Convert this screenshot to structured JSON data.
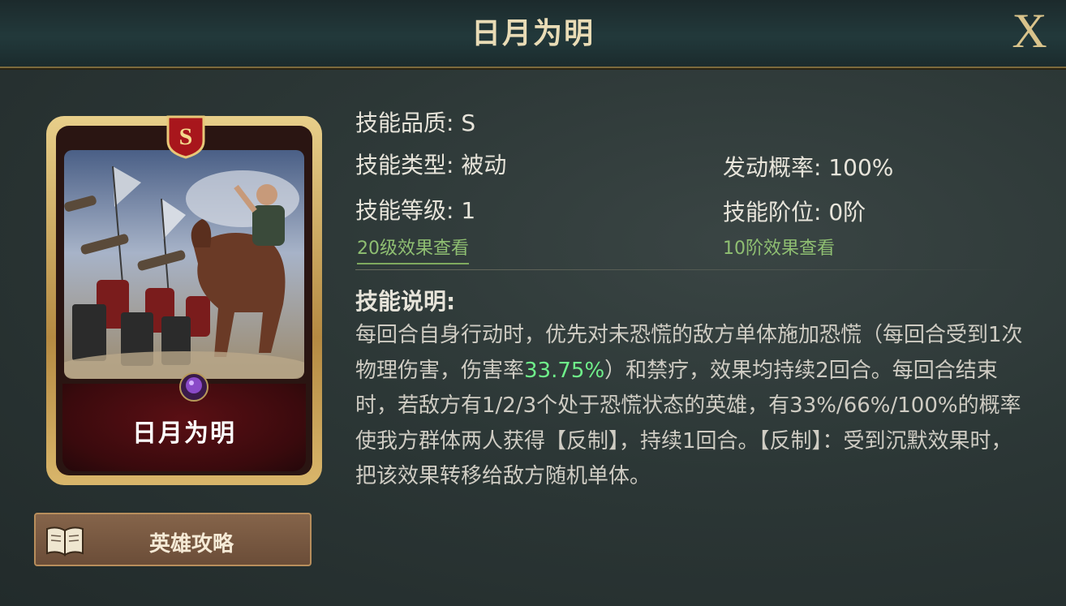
{
  "header": {
    "title": "日月为明",
    "close_label": "X"
  },
  "card": {
    "name": "日月为明",
    "quality_badge": "S"
  },
  "guide_button": {
    "label": "英雄攻略"
  },
  "stats": {
    "quality": "技能品质: S",
    "type": "技能类型: 被动",
    "level": "技能等级: 1",
    "trigger_rate": "发动概率: 100%",
    "rank": "技能阶位: 0阶"
  },
  "links": {
    "level20": "20级效果查看",
    "rank10": "10阶效果查看"
  },
  "description": {
    "title": "技能说明:",
    "part1": "每回合自身行动时，优先对未恐慌的敌方单体施加恐慌（每回合受到1次物理伤害，伤害率",
    "highlight": "33.75%",
    "part2": "）和禁疗，效果均持续2回合。每回合结束时，若敌方有1/2/3个处于恐慌状态的英雄，有33%/66%/100%的概率使我方群体两人获得【反制】，持续1回合。【反制】：受到沉默效果时，把该效果转移给敌方随机单体。"
  },
  "colors": {
    "highlight_green": "#6ff08a",
    "link_green": "#8fbf72",
    "gold": "#d9c38b"
  }
}
